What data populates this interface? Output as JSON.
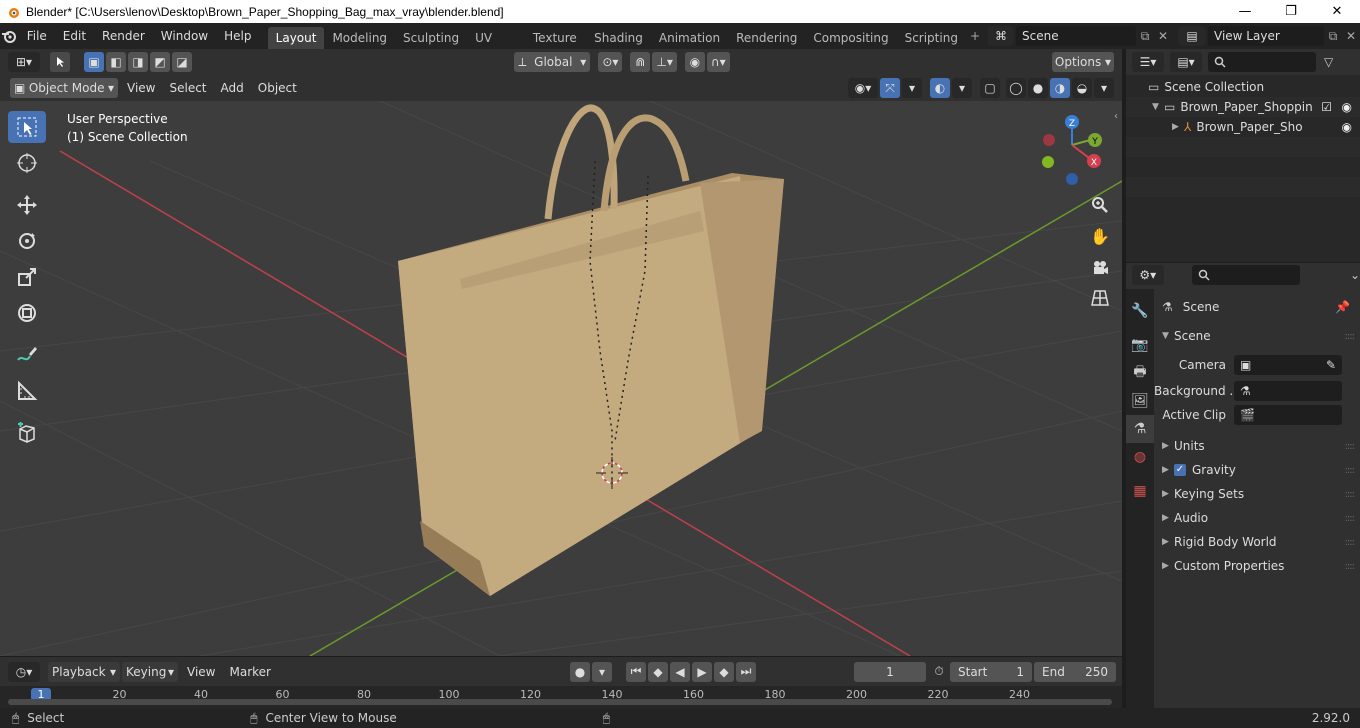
{
  "window": {
    "title": "Blender* [C:\\Users\\lenov\\Desktop\\Brown_Paper_Shopping_Bag_max_vray\\blender.blend]",
    "min": "—",
    "max": "❐",
    "close": "✕"
  },
  "menu": {
    "items": [
      "File",
      "Edit",
      "Render",
      "Window",
      "Help"
    ],
    "workspaces": [
      "Layout",
      "Modeling",
      "Sculpting",
      "UV Editing",
      "Texture Paint",
      "Shading",
      "Animation",
      "Rendering",
      "Compositing",
      "Scripting"
    ],
    "active_workspace": "Layout",
    "add_tab": "+",
    "scene_name": "Scene",
    "view_layer": "View Layer"
  },
  "viewport_header": {
    "transform_orientation": "Global",
    "options_label": "Options",
    "mode": "Object Mode",
    "menus": [
      "View",
      "Select",
      "Add",
      "Object"
    ]
  },
  "viewport": {
    "perspective": "User Perspective",
    "collection": "(1) Scene Collection",
    "gizmo": {
      "x": "X",
      "y": "Y",
      "z": "Z"
    }
  },
  "outliner": {
    "rows": [
      "Scene Collection",
      "Brown_Paper_Shopping_I",
      "Brown_Paper_Shoppi"
    ]
  },
  "properties": {
    "context": "Scene",
    "panel_scene": "Scene",
    "camera_label": "Camera",
    "background_label": "Background ...",
    "active_clip_label": "Active Clip",
    "panels": [
      "Units",
      "Gravity",
      "Keying Sets",
      "Audio",
      "Rigid Body World",
      "Custom Properties"
    ],
    "gravity_checked": true
  },
  "timeline": {
    "menus": [
      "Playback",
      "Keying",
      "View",
      "Marker"
    ],
    "current_frame": "1",
    "start_label": "Start",
    "start": "1",
    "end_label": "End",
    "end": "250",
    "ruler_ticks": [
      "1",
      "20",
      "40",
      "60",
      "80",
      "100",
      "120",
      "140",
      "160",
      "180",
      "200",
      "220",
      "240"
    ]
  },
  "statusbar": {
    "select": "Select",
    "center_view": "Center View to Mouse",
    "version": "2.92.0"
  },
  "colors": {
    "accent": "#4772b3",
    "viewport_bg": "#3d3d3d",
    "axis_x": "#c0404a",
    "axis_y": "#6a9a2a",
    "bag": "#c4aa7f"
  }
}
